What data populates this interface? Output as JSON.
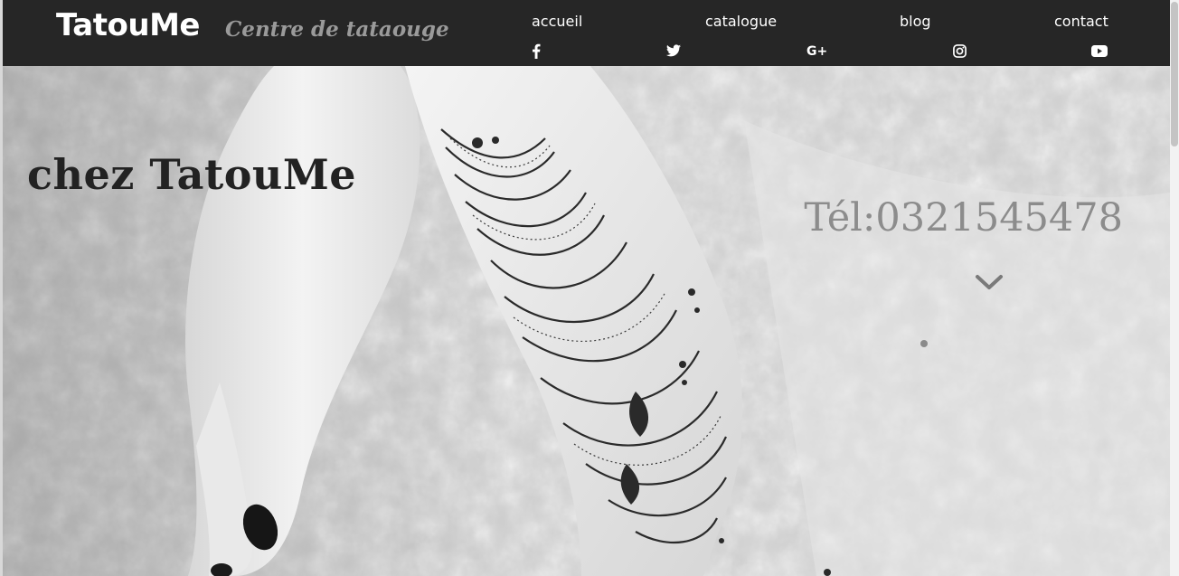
{
  "header": {
    "brand": "TatouMe",
    "tagline": "Centre de tataouge"
  },
  "nav": {
    "items": [
      {
        "label": "accueil"
      },
      {
        "label": "catalogue"
      },
      {
        "label": "blog"
      },
      {
        "label": "contact"
      }
    ]
  },
  "social": {
    "icons": [
      "facebook-icon",
      "twitter-icon",
      "google-plus-icon",
      "instagram-icon",
      "youtube-icon"
    ]
  },
  "hero": {
    "title": "chez TatouMe",
    "phone": "Tél:0321545478",
    "scroll_icon": "chevron-down-icon"
  },
  "colors": {
    "header_bg": "#262626",
    "tagline": "#9a9a9a",
    "title": "#222222",
    "phone": "#8c8c8c"
  }
}
